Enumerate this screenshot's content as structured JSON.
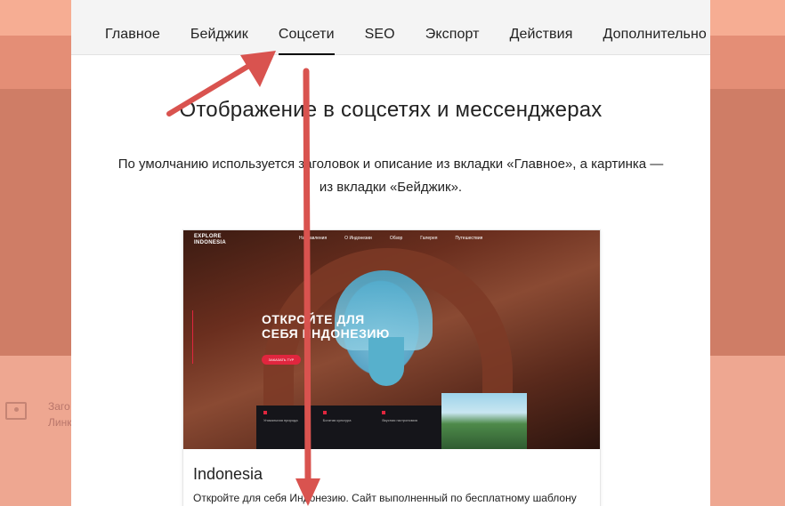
{
  "background": {
    "partial_text_line1": "Заго",
    "partial_text_line2": "Линк"
  },
  "tabs": [
    {
      "label": "Главное",
      "active": false
    },
    {
      "label": "Бейджик",
      "active": false
    },
    {
      "label": "Соцсети",
      "active": true
    },
    {
      "label": "SEO",
      "active": false
    },
    {
      "label": "Экспорт",
      "active": false
    },
    {
      "label": "Действия",
      "active": false
    },
    {
      "label": "Дополнительно",
      "active": false
    }
  ],
  "section": {
    "title": "Отображение в соцсетях и мессенджерах",
    "description": "По умолчанию используется заголовок и описание из вкладки «Главное», а картинка — из вкладки «Бейджик»."
  },
  "preview": {
    "image": {
      "logo_line1": "EXPLORE",
      "logo_line2": "INDONESIA",
      "nav": [
        "Направления",
        "О Индонезии",
        "Обзор",
        "Галерея",
        "Путешествия"
      ],
      "hero_line1": "ОТКРОЙТЕ ДЛЯ",
      "hero_line2": "СЕБЯ ИНДОНЕЗИЮ",
      "cta": "ЗАКАЗАТЬ ТУР",
      "features": [
        "Уникальная природа",
        "Богатая культура",
        "Вкусная гастрономия"
      ]
    },
    "title": "Indonesia",
    "description": "Откройте для себя Индонезию. Сайт выполненный по бесплатному шаблону"
  },
  "colors": {
    "annotation_arrow": "#d9534f",
    "accent": "#e0263e"
  }
}
